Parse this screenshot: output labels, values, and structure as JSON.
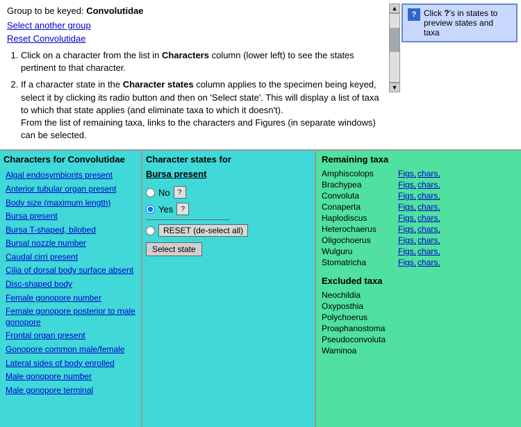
{
  "header": {
    "group_label_prefix": "Group to be keyed: ",
    "group_name": "Convolutidae",
    "select_link": "Select another group",
    "reset_link": "Reset Convolutidae",
    "instructions": [
      "Click on a character from the list in <strong>Characters</strong> column (lower left) to see the states pertinent to that character.",
      "If a character state in the <strong>Character states</strong> column applies to the specimen being keyed, select it by clicking its radio button and then on 'Select state'. This will display a list of taxa to which that state applies (and eliminate taxa to which it doesn't).\nFrom the list of remaining taxa, links to the characters and Figures (in separate windows) can be selected."
    ],
    "hint": {
      "icon_label": "?",
      "text": "'s in states to preview states and taxa"
    }
  },
  "characters_col": {
    "title": "Characters for Convolutidae",
    "items": [
      "Algal endosymbionts present",
      "Anterior tubular organ present",
      "Body size (maximum length)",
      "Bursa present",
      "Bursa T-shaped, bilobed",
      "Bursal nozzle number",
      "Caudal cirri present",
      "Cilia of dorsal body surface absent",
      "Disc-shaped body",
      "Female gonopore number",
      "Female gonopore posterior to male gonopore",
      "Frontal organ present",
      "Gonopore common male/female",
      "Lateral sides of body enrolled",
      "Male gonopore number",
      "Male gonopore terminal"
    ]
  },
  "states_col": {
    "title": "Character states for",
    "character_name": "Bursa present",
    "options": [
      {
        "value": "no",
        "label": "No",
        "selected": false
      },
      {
        "value": "yes",
        "label": "Yes",
        "selected": true
      }
    ],
    "reset_label": "RESET (de-select all)",
    "select_button": "Select state"
  },
  "taxa_col": {
    "title": "Remaining taxa",
    "remaining": [
      {
        "name": "Amphiscolops",
        "figs": "Figs,",
        "chars": "chars,"
      },
      {
        "name": "Brachypea",
        "figs": "Figs,",
        "chars": "chars,"
      },
      {
        "name": "Convoluta",
        "figs": "Figs,",
        "chars": "chars,"
      },
      {
        "name": "Conaperta",
        "figs": "Figs,",
        "chars": "chars,"
      },
      {
        "name": "Haplodiscus",
        "figs": "Figs,",
        "chars": "chars,"
      },
      {
        "name": "Heterochaerus",
        "figs": "Figs,",
        "chars": "chars,"
      },
      {
        "name": "Oligochoerus",
        "figs": "Figs,",
        "chars": "chars,"
      },
      {
        "name": "Wulguru",
        "figs": "Figs,",
        "chars": "chars,"
      },
      {
        "name": "Stomatricha",
        "figs": "Figs,",
        "chars": "chars,"
      }
    ],
    "excluded_title": "Excluded taxa",
    "excluded": [
      "Neochildia",
      "Oxyposthia",
      "Polychoerus",
      "Proaphanostoma",
      "Pseudoconvoluta",
      "Waminoa"
    ]
  }
}
